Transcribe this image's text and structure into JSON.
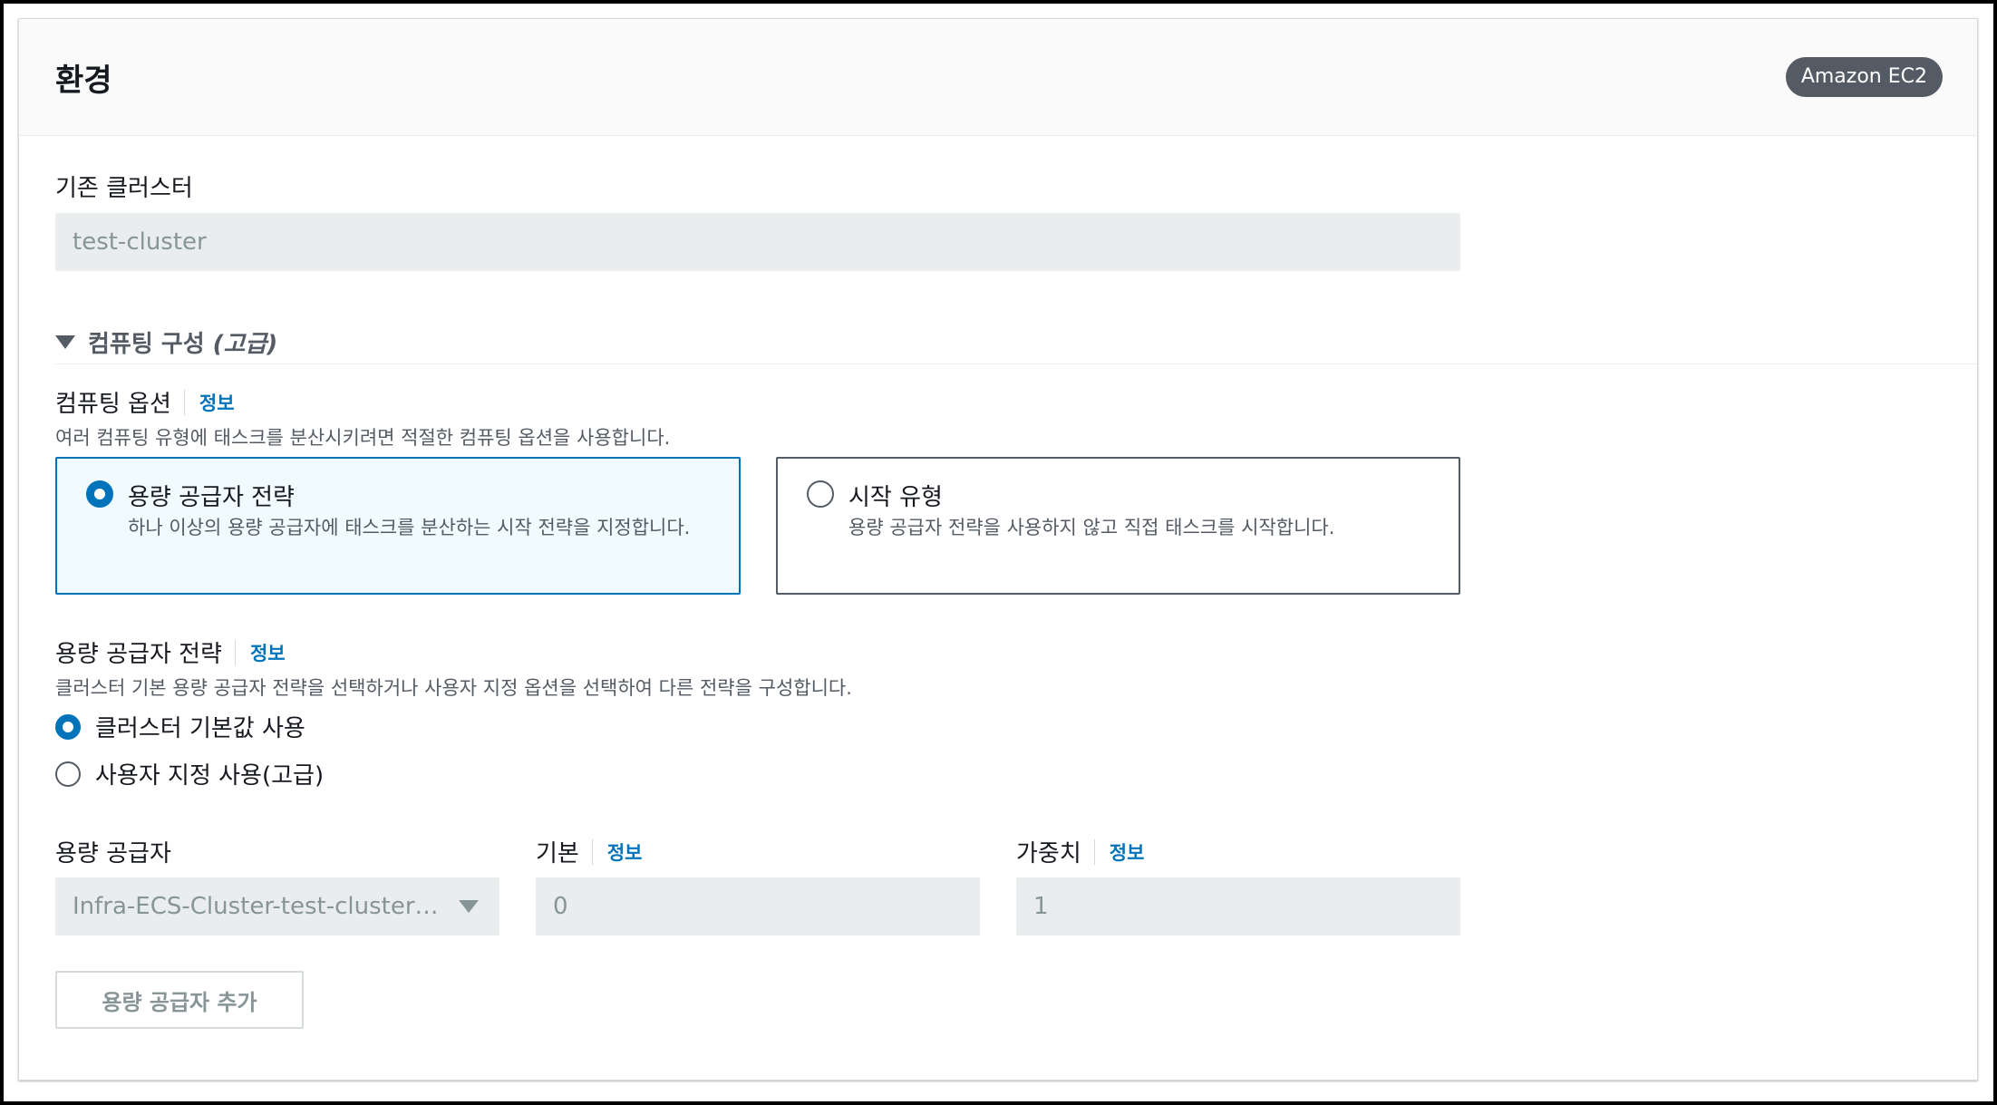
{
  "header": {
    "title": "환경",
    "badge": "Amazon EC2"
  },
  "existing_cluster": {
    "label": "기존 클러스터",
    "value": "test-cluster"
  },
  "compute_config": {
    "title": "컴퓨팅 구성",
    "title_suffix": "(고급)",
    "expanded": true
  },
  "compute_options": {
    "label": "컴퓨팅 옵션",
    "info": "정보",
    "description": "여러 컴퓨팅 유형에 태스크를 분산시키려면 적절한 컴퓨팅 옵션을 사용합니다.",
    "tiles": [
      {
        "title": "용량 공급자 전략",
        "description": "하나 이상의 용량 공급자에 태스크를 분산하는 시작 전략을 지정합니다.",
        "selected": true
      },
      {
        "title": "시작 유형",
        "description": "용량 공급자 전략을 사용하지 않고 직접 태스크를 시작합니다.",
        "selected": false
      }
    ]
  },
  "capacity_strategy": {
    "label": "용량 공급자 전략",
    "info": "정보",
    "description": "클러스터 기본 용량 공급자 전략을 선택하거나 사용자 지정 옵션을 선택하여 다른 전략을 구성합니다.",
    "options": [
      {
        "label": "클러스터 기본값 사용",
        "selected": true
      },
      {
        "label": "사용자 지정 사용(고급)",
        "selected": false
      }
    ]
  },
  "provider_row": {
    "provider_label": "용량 공급자",
    "provider_value": "Infra-ECS-Cluster-test-cluster…",
    "base_label": "기본",
    "base_info": "정보",
    "base_value": "0",
    "weight_label": "가중치",
    "weight_info": "정보",
    "weight_value": "1"
  },
  "add_provider_button": "용량 공급자 추가",
  "colors": {
    "accent": "#0073bb",
    "selected_tile_bg": "#f1faff",
    "disabled_input_bg": "#eaeded",
    "badge_bg": "#545b64"
  }
}
